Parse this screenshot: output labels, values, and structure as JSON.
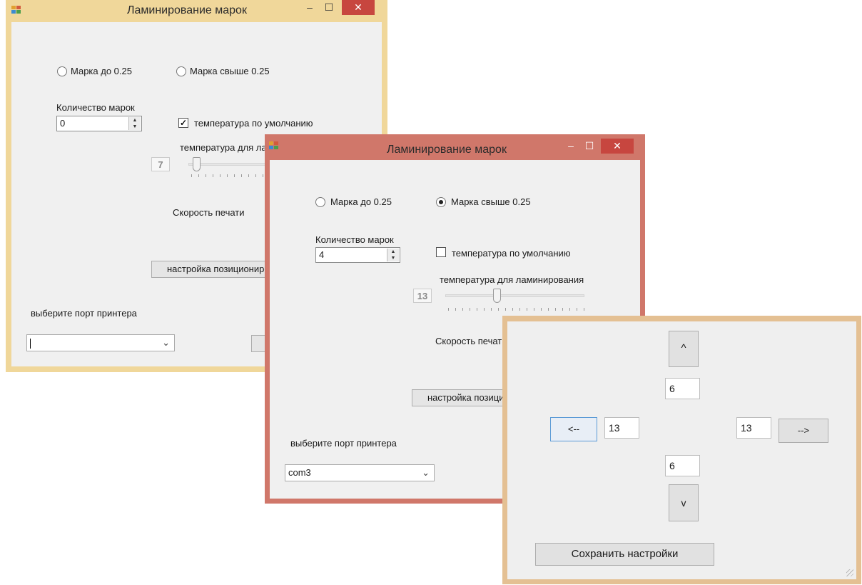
{
  "window_back": {
    "title": "Ламинирование марок",
    "radio1_label": "Марка до 0.25",
    "radio2_label": "Марка свыше 0.25",
    "count_label": "Количество марок",
    "count_value": "0",
    "default_temp_label": "температура по умолчанию",
    "temp_label": "температура для ламинирования",
    "temp_value": "7",
    "speed_label": "Скорость печати",
    "position_button": "настройка позиционирования",
    "port_label": "выберите порт принтера",
    "port_value": "",
    "controls": {
      "minimize": "–",
      "maximize": "☐",
      "close": "✕"
    }
  },
  "window_middle": {
    "title": "Ламинирование марок",
    "radio1_label": "Марка до 0.25",
    "radio2_label": "Марка свыше 0.25",
    "count_label": "Количество марок",
    "count_value": "4",
    "default_temp_label": "температура по умолчанию",
    "temp_label": "температура для ламинирования",
    "temp_value": "13",
    "speed_label": "Скорость печати",
    "position_button": "настройка позиционирования",
    "port_label": "выберите порт принтера",
    "port_value": "com3",
    "controls": {
      "minimize": "–",
      "maximize": "☐",
      "close": "✕"
    }
  },
  "window_front": {
    "up_button": "^",
    "top_value": "6",
    "left_button": "<--",
    "left_value": "13",
    "right_value": "13",
    "right_button": "-->",
    "bottom_value": "6",
    "down_button": "v",
    "save_button": "Сохранить настройки"
  },
  "icons": {
    "spin_up": "▲",
    "spin_down": "▼",
    "dropdown": "⌄",
    "check": "✓"
  },
  "colors": {
    "back_border": "#f0d79a",
    "middle_border": "#d0776a",
    "front_border": "#e4c093",
    "close_red": "#c7463f"
  }
}
